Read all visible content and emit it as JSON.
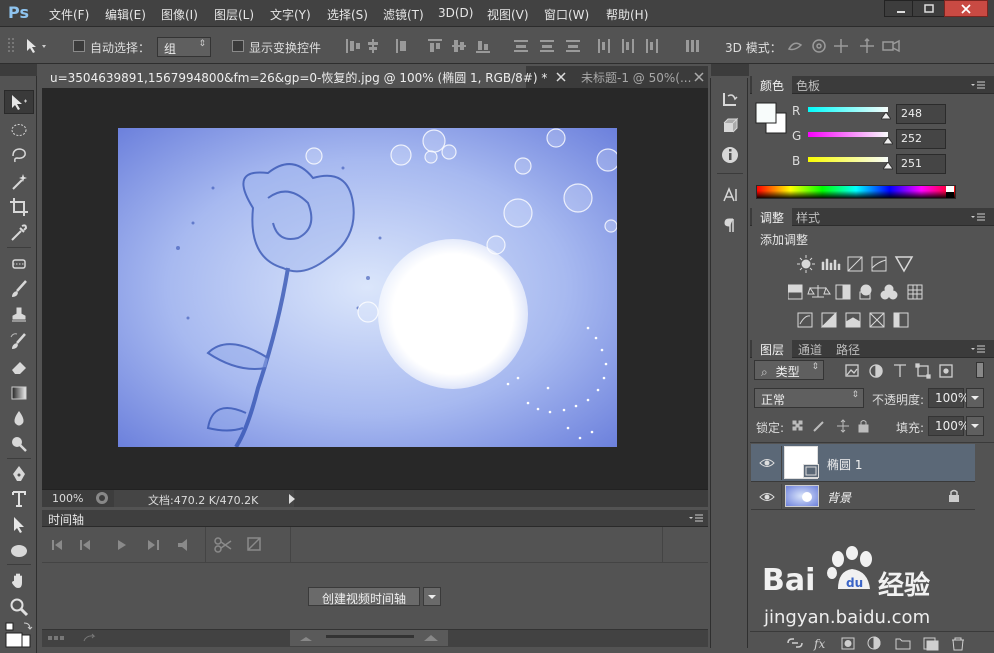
{
  "app": {
    "logo": "Ps"
  },
  "menu": {
    "items": [
      "文件(F)",
      "编辑(E)",
      "图像(I)",
      "图层(L)",
      "文字(Y)",
      "选择(S)",
      "滤镜(T)",
      "3D(D)",
      "视图(V)",
      "窗口(W)",
      "帮助(H)"
    ]
  },
  "options_bar": {
    "auto_select_label": "自动选择：",
    "auto_select_value": "组",
    "show_transform_label": "显示变换控件",
    "mode_3d_label": "3D 模式："
  },
  "documents": {
    "tabs": [
      {
        "label": "u=3504639891,1567994800&fm=26&gp=0-恢复的.jpg @ 100% (椭圆 1, RGB/8#) *",
        "active": true
      },
      {
        "label": "未标题-1 @ 50%(...",
        "active": false
      }
    ],
    "zoom": "100%",
    "doc_info": "文档:470.2 K/470.2K"
  },
  "timeline": {
    "tab_label": "时间轴",
    "create_button": "创建视频时间轴"
  },
  "color_panel": {
    "tabs": [
      "颜色",
      "色板"
    ],
    "r_label": "R",
    "g_label": "G",
    "b_label": "B",
    "r": "248",
    "g": "252",
    "b": "251"
  },
  "adjustments_panel": {
    "tabs": [
      "调整",
      "样式"
    ],
    "title": "添加调整"
  },
  "layers_panel": {
    "tabs": [
      "图层",
      "通道",
      "路径"
    ],
    "filter_kind": "类型",
    "blend_mode": "正常",
    "opacity_label": "不透明度:",
    "opacity": "100%",
    "lock_label": "锁定:",
    "fill_label": "填充:",
    "fill": "100%",
    "layers": [
      {
        "name": "椭圆 1",
        "selected": true
      },
      {
        "name": "背景",
        "selected": false
      }
    ]
  },
  "watermark": {
    "brand": "Bai",
    "brand_cn": "经验",
    "url": "jingyan.baidu.com"
  },
  "colors": {
    "accent": "#8fc4ef",
    "selected_layer": "#5b6877",
    "canvas_bg": "#282828"
  }
}
